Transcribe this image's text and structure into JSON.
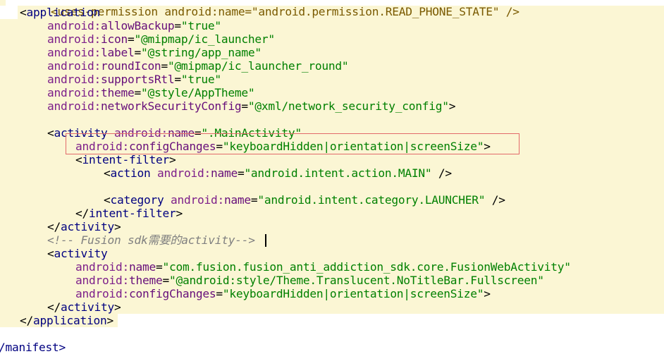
{
  "colors": {
    "background": "#ffffff",
    "highlight": "#fbf6d4",
    "tag": "#000080",
    "attribute": "#660e7a",
    "value": "#008000",
    "comment": "#808080",
    "selection_box": "#e26a6a"
  },
  "code": {
    "line0": {
      "tag": "<uses-permission android:name=\"android.permission.READ_PHONE_STATE\" />"
    },
    "line1": {
      "open": "<",
      "tag": "application"
    },
    "line2": {
      "ns": "android:",
      "attr": "allowBackup",
      "eq": "=",
      "val": "\"true\""
    },
    "line3": {
      "ns": "android:",
      "attr": "icon",
      "eq": "=",
      "val": "\"@mipmap/ic_launcher\""
    },
    "line4": {
      "ns": "android:",
      "attr": "label",
      "eq": "=",
      "val": "\"@string/app_name\""
    },
    "line5": {
      "ns": "android:",
      "attr": "roundIcon",
      "eq": "=",
      "val": "\"@mipmap/ic_launcher_round\""
    },
    "line6": {
      "ns": "android:",
      "attr": "supportsRtl",
      "eq": "=",
      "val": "\"true\""
    },
    "line7": {
      "ns": "android:",
      "attr": "theme",
      "eq": "=",
      "val": "\"@style/AppTheme\""
    },
    "line8": {
      "ns": "android:",
      "attr": "networkSecurityConfig",
      "eq": "=",
      "val": "\"@xml/network_security_config\"",
      "close": ">"
    },
    "line10": {
      "open": "<",
      "tag": "activity",
      "ns": "android:",
      "attr": "name",
      "eq": "=",
      "val": "\".MainActivity\""
    },
    "line11": {
      "ns": "android:",
      "attr": "configChanges",
      "eq": "=",
      "val": "\"keyboardHidden|orientation|screenSize\"",
      "close": ">"
    },
    "line12": {
      "open": "<",
      "tag": "intent-filter",
      "close": ">"
    },
    "line13": {
      "open": "<",
      "tag": "action",
      "ns": "android:",
      "attr": "name",
      "eq": "=",
      "val": "\"android.intent.action.MAIN\"",
      "close": " />"
    },
    "line15": {
      "open": "<",
      "tag": "category",
      "ns": "android:",
      "attr": "name",
      "eq": "=",
      "val": "\"android.intent.category.LAUNCHER\"",
      "close": " />"
    },
    "line16": {
      "open": "</",
      "tag": "intent-filter",
      "close": ">"
    },
    "line17": {
      "open": "</",
      "tag": "activity",
      "close": ">"
    },
    "line18": {
      "comment": "<!-- Fusion sdk需要的activity-->"
    },
    "line19": {
      "open": "<",
      "tag": "activity"
    },
    "line20": {
      "ns": "android:",
      "attr": "name",
      "eq": "=",
      "val": "\"com.fusion.fusion_anti_addiction_sdk.core.FusionWebActivity\""
    },
    "line21": {
      "ns": "android:",
      "attr": "theme",
      "eq": "=",
      "val": "\"@android:style/Theme.Translucent.NoTitleBar.Fullscreen\""
    },
    "line22": {
      "ns": "android:",
      "attr": "configChanges",
      "eq": "=",
      "val": "\"keyboardHidden|orientation|screenSize\"",
      "close": ">"
    },
    "line23": {
      "open": "</",
      "tag": "activity",
      "close": ">"
    },
    "line24": {
      "open": "</",
      "tag": "application",
      "close": ">"
    },
    "line26": {
      "text": "/manifest>"
    }
  }
}
